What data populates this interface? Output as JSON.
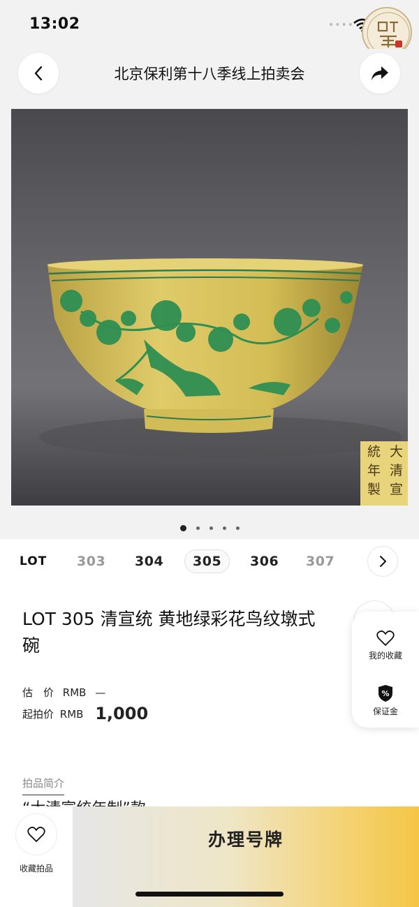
{
  "status_bar": {
    "time": "13:02",
    "signal": "••••"
  },
  "header": {
    "title": "北京保利第十八季线上拍卖会",
    "back_icon": "chevron-left-icon",
    "share_icon": "share-arrow-icon"
  },
  "gallery": {
    "image_count": 5,
    "active_index": 0,
    "seal_mark": "大清宣統年製"
  },
  "lot_nav": {
    "prefix": "LOT",
    "lots": [
      {
        "number": "303",
        "state": "faded"
      },
      {
        "number": "304",
        "state": "normal"
      },
      {
        "number": "305",
        "state": "current"
      },
      {
        "number": "306",
        "state": "normal"
      },
      {
        "number": "307",
        "state": "faded"
      }
    ],
    "next_icon": "chevron-right-icon"
  },
  "lot": {
    "title": "LOT 305 清宣统 黄地绿彩花鸟纹墩式碗",
    "estimate_label": "估　价",
    "estimate_currency": "RMB",
    "estimate_value": "—",
    "start_label": "起拍价",
    "start_currency": "RMB",
    "start_value": "1,000"
  },
  "side_panel": {
    "favorites_label": "我的收藏",
    "deposit_label": "保证金",
    "deposit_symbol": "%"
  },
  "intro": {
    "label": "拍品简介",
    "text": "“大清宣统年制”款"
  },
  "bottom_bar": {
    "favorite_label": "收藏拍品",
    "register_label": "办理号牌"
  },
  "colors": {
    "accent_gold": "#f5c545",
    "bowl_yellow": "#d9c25a",
    "bowl_green": "#2f8f52"
  }
}
